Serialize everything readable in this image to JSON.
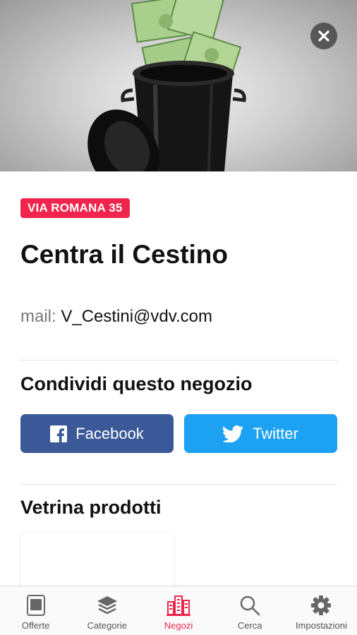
{
  "hero": {
    "image_alt": "trash can with euro banknotes"
  },
  "store": {
    "address_badge": "VIA ROMANA 35",
    "name": "Centra il Cestino",
    "mail_label": "mail:",
    "mail_value": "V_Cestini@vdv.com"
  },
  "share": {
    "title": "Condividi questo negozio",
    "facebook_label": "Facebook",
    "twitter_label": "Twitter"
  },
  "showcase": {
    "title": "Vetrina prodotti"
  },
  "tabs": [
    {
      "label": "Offerte",
      "icon": "offers-icon",
      "active": false
    },
    {
      "label": "Categorie",
      "icon": "layers-icon",
      "active": false
    },
    {
      "label": "Negozi",
      "icon": "stores-icon",
      "active": true
    },
    {
      "label": "Cerca",
      "icon": "search-icon",
      "active": false
    },
    {
      "label": "Impostazioni",
      "icon": "gear-icon",
      "active": false
    }
  ],
  "colors": {
    "accent": "#f0244c",
    "facebook": "#3b5998",
    "twitter": "#1da1f2"
  }
}
